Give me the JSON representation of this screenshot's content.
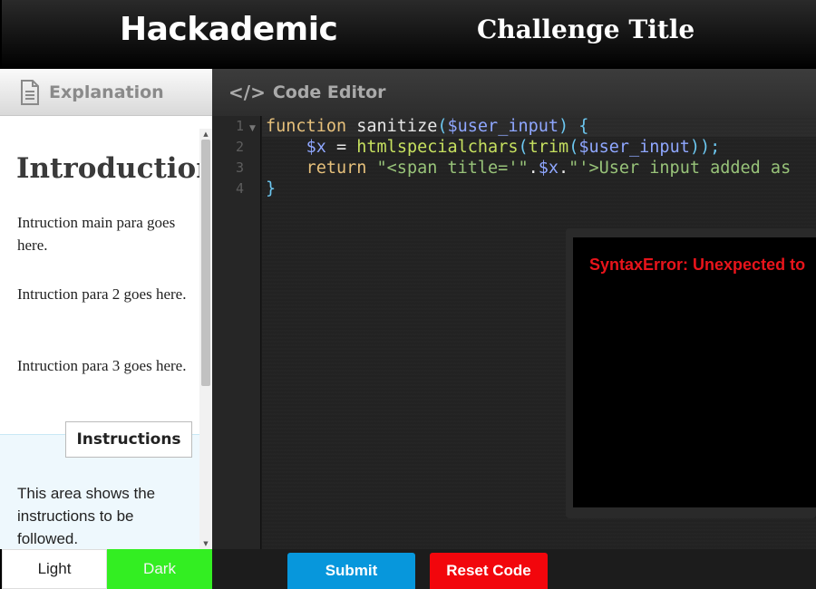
{
  "header": {
    "brand": "Hackademic",
    "challenge_title": "Challenge Title"
  },
  "explanation": {
    "tab_label": "Explanation",
    "tab_icon": "document-icon",
    "heading": "Introduction",
    "paragraphs": [
      "Intruction main para goes here.",
      "Intruction para 2 goes here.",
      "Intruction para 3 goes here."
    ],
    "instructions_tab": "Instructions",
    "instructions_text": "This area shows the instructions to be followed."
  },
  "editor": {
    "tab_label": "Code Editor",
    "tab_icon": "code-icon",
    "icon_glyph": "</>",
    "line_numbers": [
      "1",
      "2",
      "3",
      "4"
    ],
    "code": {
      "l1_kw": "function",
      "l1_fn": " sanitize",
      "l1_open": "(",
      "l1_var": "$user_input",
      "l1_close": ") {",
      "l2_indent": "    ",
      "l2_var": "$x",
      "l2_op": " = ",
      "l2_fn": "htmlspecialchars",
      "l2_open": "(",
      "l2_fn2": "trim",
      "l2_open2": "(",
      "l2_var2": "$user_input",
      "l2_close": "));",
      "l3_indent": "    ",
      "l3_kw": "return",
      "l3_str1": " \"<span title='\"",
      "l3_dot1": ".",
      "l3_var": "$x",
      "l3_dot2": ".",
      "l3_str2": "\"'>User input added as",
      "l4": "}"
    }
  },
  "output": {
    "error": "SyntaxError: Unexpected to"
  },
  "theme": {
    "light_label": "Light",
    "dark_label": "Dark"
  },
  "actions": {
    "submit_label": "Submit",
    "reset_label": "Reset Code"
  },
  "colors": {
    "submit": "#0797dc",
    "reset": "#f2060c",
    "dark_theme": "#33ee22",
    "error_text": "#e8141b"
  }
}
